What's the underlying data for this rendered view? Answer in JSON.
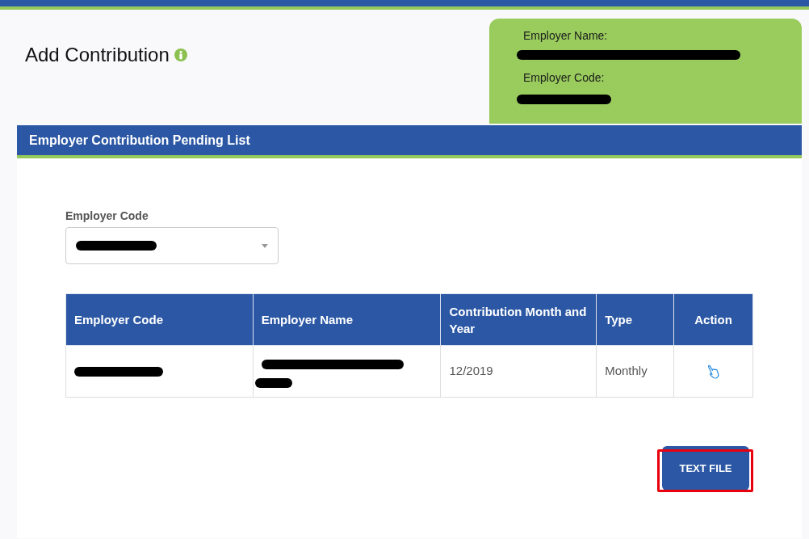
{
  "page": {
    "title": "Add Contribution"
  },
  "employer_panel": {
    "fields": [
      {
        "label": "Employer Name:",
        "redacted": true
      },
      {
        "label": "Employer Code:",
        "redacted": true
      }
    ]
  },
  "section": {
    "title": "Employer Contribution Pending List"
  },
  "filter": {
    "label": "Employer Code",
    "select": {
      "redacted": true
    }
  },
  "table": {
    "columns": [
      "Employer Code",
      "Employer Name",
      "Contribution Month and Year",
      "Type",
      "Action"
    ],
    "rows": [
      {
        "cells": [
          {
            "kind": "redacted"
          },
          {
            "kind": "redacted_multiline"
          },
          {
            "kind": "text",
            "text": "12/2019"
          },
          {
            "kind": "text",
            "text": "Monthly"
          },
          {
            "kind": "action"
          }
        ]
      }
    ]
  },
  "buttons": [
    {
      "label": "TEXT FILE",
      "highlighted": true
    }
  ]
}
